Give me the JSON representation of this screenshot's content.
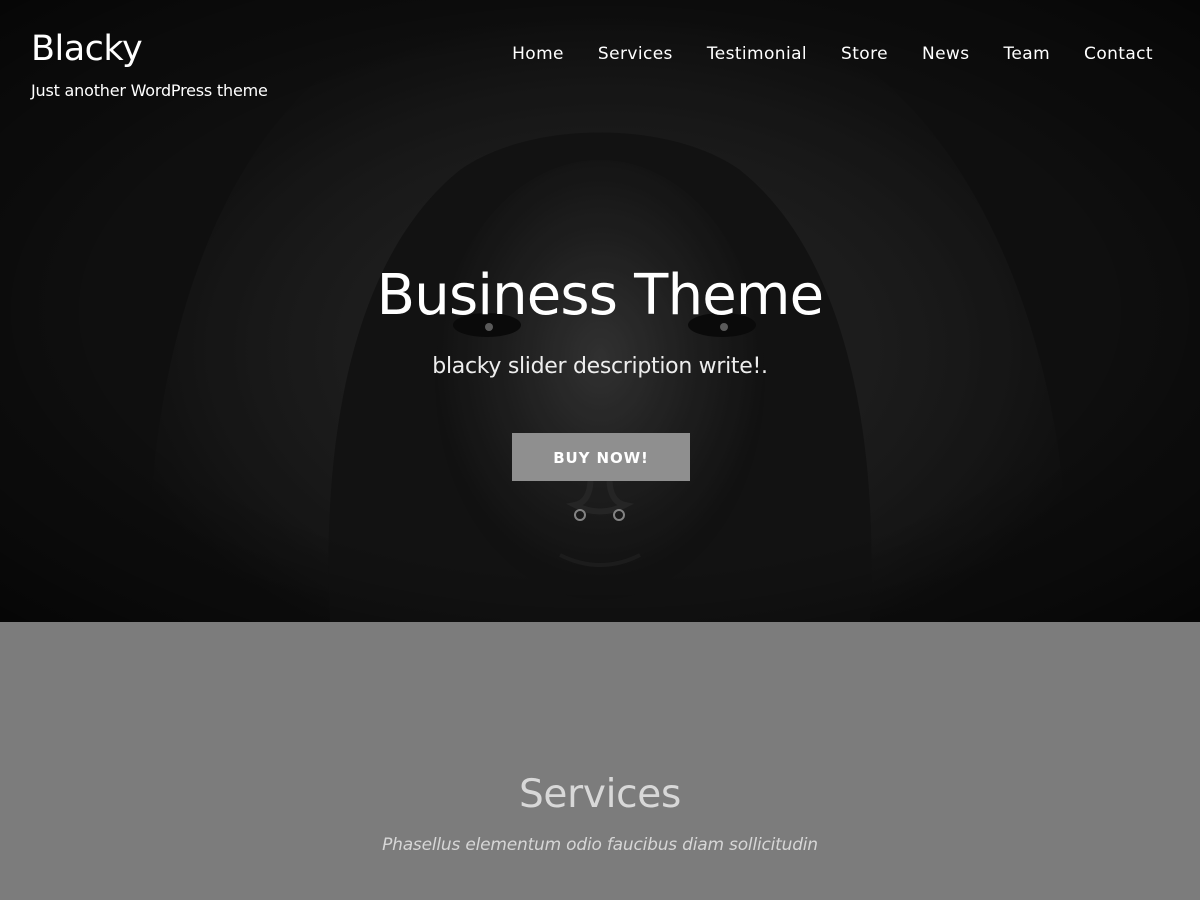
{
  "site": {
    "title": "Blacky",
    "tagline": "Just another WordPress theme"
  },
  "nav": {
    "items": [
      {
        "label": "Home"
      },
      {
        "label": "Services"
      },
      {
        "label": "Testimonial"
      },
      {
        "label": "Store"
      },
      {
        "label": "News"
      },
      {
        "label": "Team"
      },
      {
        "label": "Contact"
      }
    ]
  },
  "hero": {
    "title": "Business Theme",
    "description": "blacky slider description write!.",
    "button_label": "BUY NOW!",
    "image": "hooded-face-portrait"
  },
  "services": {
    "title": "Services",
    "subtitle": "Phasellus elementum odio faucibus diam sollicitudin"
  },
  "colors": {
    "hero_background": "#121212",
    "button_background": "#8f8f8f",
    "services_background": "#7c7c7c",
    "text_light": "#ffffff"
  }
}
